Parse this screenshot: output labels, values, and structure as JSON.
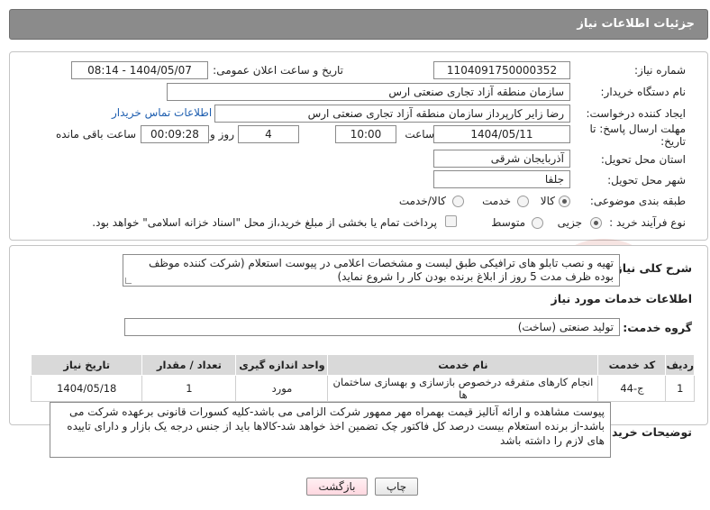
{
  "header": {
    "title": "جزئیات اطلاعات نیاز"
  },
  "form": {
    "need_number_label": "شماره نیاز:",
    "need_number": "1104091750000352",
    "announce_label": "تاریخ و ساعت اعلان عمومی:",
    "announce_value": "1404/05/07 - 08:14",
    "buyer_org_label": "نام دستگاه خریدار:",
    "buyer_org": "سازمان منطقه آزاد تجاری صنعتی ارس",
    "requester_label": "ایجاد کننده درخواست:",
    "requester": "رضا زایر کارپرداز سازمان منطقه آزاد تجاری صنعتی ارس",
    "contact_link": "اطلاعات تماس خریدار",
    "deadline_label_1": "مهلت ارسال پاسخ: تا",
    "deadline_label_2": "تاریخ:",
    "deadline_date": "1404/05/11",
    "time_label": "ساعت",
    "deadline_time": "10:00",
    "days_value": "4",
    "days_label": "روز و",
    "remaining_time": "00:09:28",
    "remaining_label": "ساعت باقی مانده",
    "province_label": "استان محل تحویل:",
    "province": "آذربایجان شرقی",
    "city_label": "شهر محل تحویل:",
    "city": "جلفا",
    "category_label": "طبقه بندی موضوعی:",
    "category_options": {
      "goods": "کالا",
      "service": "خدمت",
      "goods_service": "کالا/خدمت"
    },
    "process_label": "نوع فرآیند خرید :",
    "process_options": {
      "partial": "جزیی",
      "medium": "متوسط"
    },
    "payment_note": "پرداخت تمام یا بخشی از مبلغ خرید،از محل \"اسناد خزانه اسلامی\" خواهد بود."
  },
  "description": {
    "label": "شرح کلی نیاز:",
    "text": "تهیه و نصب تابلو های ترافیکی طبق لیست و مشخصات اعلامی در پیوست استعلام (شرکت کننده موظف بوده ظرف مدت 5 روز از ابلاغ برنده بودن کار را شروع نماید)"
  },
  "services": {
    "section_title": "اطلاعات خدمات مورد نیاز",
    "group_label": "گروه خدمت:",
    "group_value": "تولید صنعتی (ساخت)",
    "columns": [
      "ردیف",
      "کد خدمت",
      "نام خدمت",
      "واحد اندازه گیری",
      "تعداد / مقدار",
      "تاریخ نیاز"
    ],
    "rows": [
      [
        "1",
        "ج-44",
        "انجام کارهای متفرقه درخصوص بازسازی و بهسازی ساختمان ها",
        "مورد",
        "1",
        "1404/05/18"
      ]
    ]
  },
  "notes": {
    "label": "توضیحات خریدار:",
    "text": "پیوست مشاهده و ارائه آنالیز قیمت بهمراه مهر ممهور شرکت الزامی می باشد-کلیه کسورات قانونی برعهده شرکت می باشد-از برنده استعلام بیست درصد کل فاکتور چک تضمین اخذ خواهد شد-کالاها باید از جنس درجه یک بازار و دارای تاییده های لازم را داشته باشد"
  },
  "buttons": {
    "print": "چاپ",
    "back": "بازگشت"
  },
  "colors": {
    "header_bg": "#8b8b8b",
    "link": "#1f5fb0",
    "table_header": "#d9d9d9"
  }
}
